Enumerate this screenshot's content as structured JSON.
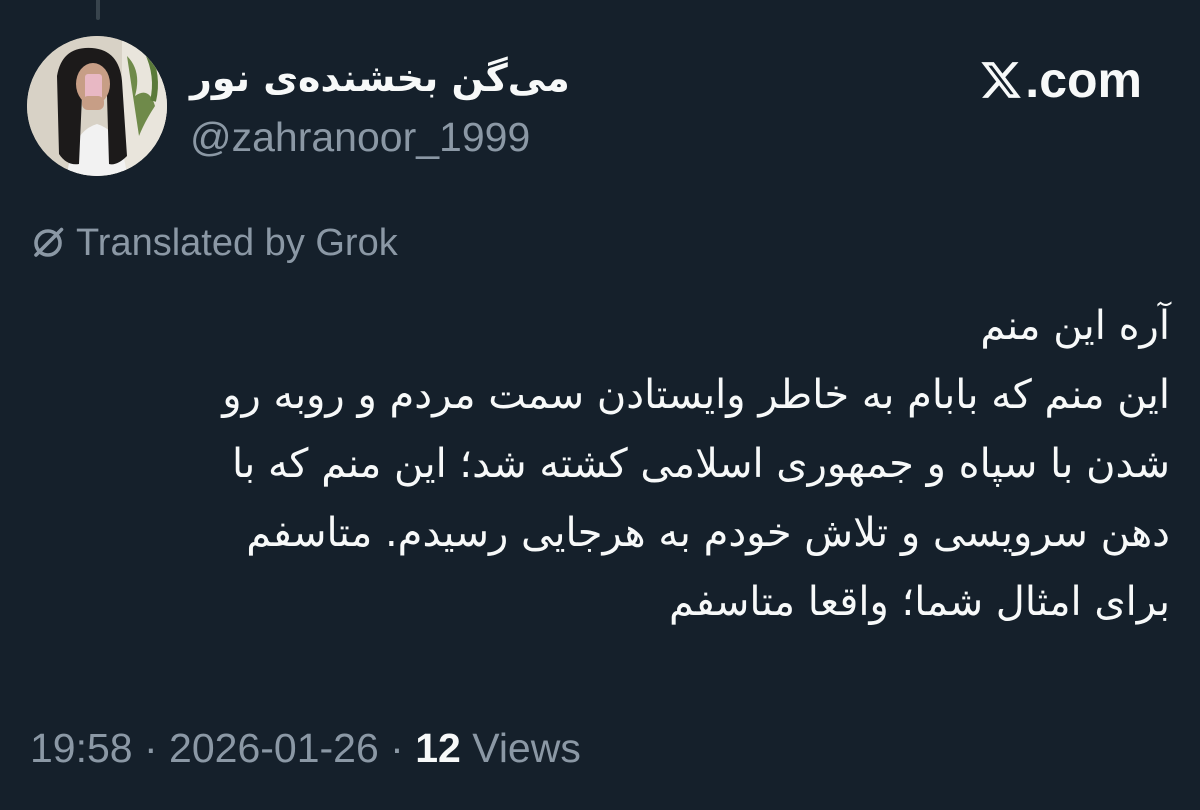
{
  "author": {
    "display_name": "می‌گن بخشنده‌ی نور",
    "handle": "@zahranoor_1999",
    "avatar_icon": "profile-photo"
  },
  "brand": {
    "logo_icon": "x-logo-icon",
    "label": ".com"
  },
  "translation": {
    "icon": "grok-icon",
    "label": "Translated by Grok"
  },
  "tweet": {
    "lines": [
      "آره این منم",
      "این منم که بابام به خاطر وایستادن سمت مردم و روبه رو",
      "شدن با سپاه و جمهوری اسلامی کشته شد؛ این منم که با",
      "دهن سرویسی و تلاش خودم به هرجایی رسیدم. متاسفم",
      "برای امثال شما؛ واقعا متاسفم"
    ]
  },
  "meta": {
    "time": "19:58",
    "separator": " · ",
    "date": "2026-01-26",
    "views_count": "12",
    "views_label": " Views"
  },
  "colors": {
    "background": "#15202b",
    "primary_text": "#f7f9f9",
    "secondary_text": "#8b98a5"
  }
}
